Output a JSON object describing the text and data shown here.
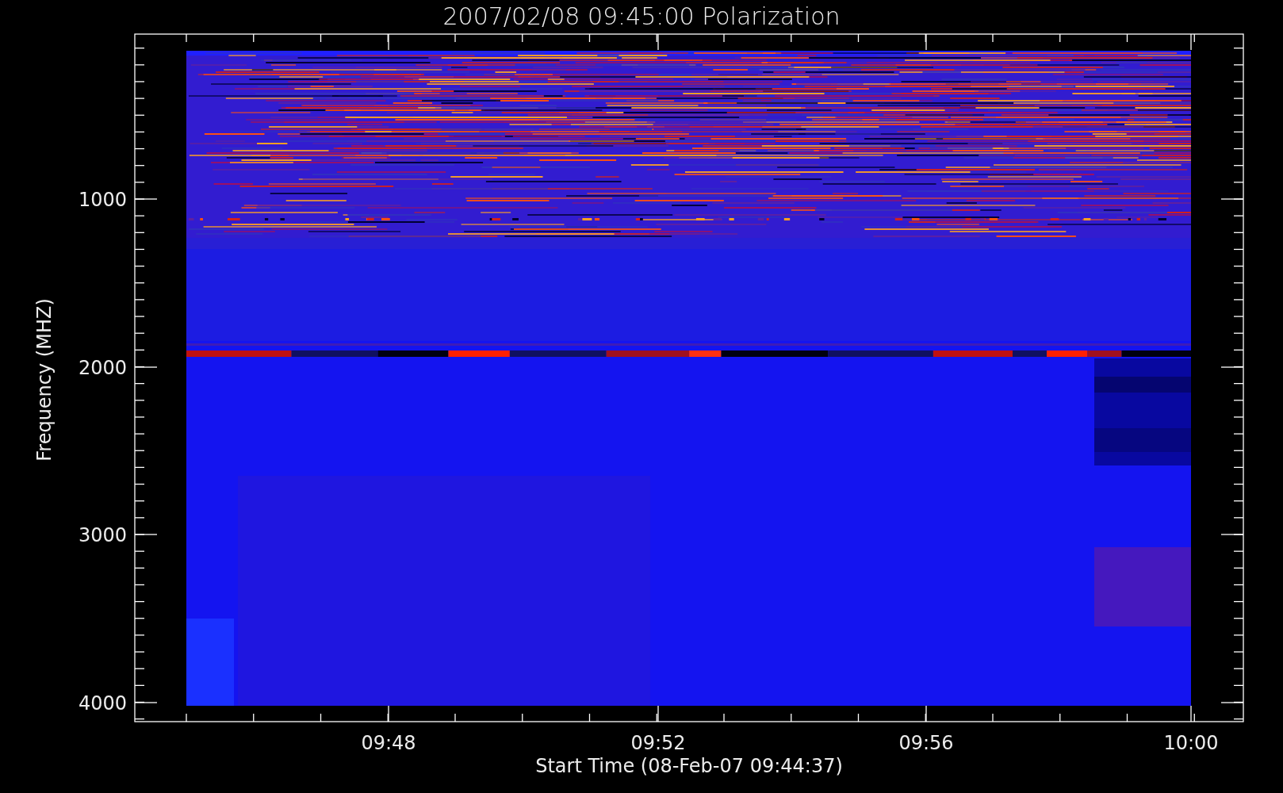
{
  "plot": {
    "title": "2007/02/08 09:45:00 Polarization",
    "ylabel": "Frequency (MHZ)",
    "xlabel": "Start Time (08-Feb-07 09:44:37)",
    "yticks": [
      "1000",
      "2000",
      "3000",
      "4000"
    ],
    "xticks": [
      "09:48",
      "09:52",
      "09:56",
      "10:00"
    ]
  }
}
